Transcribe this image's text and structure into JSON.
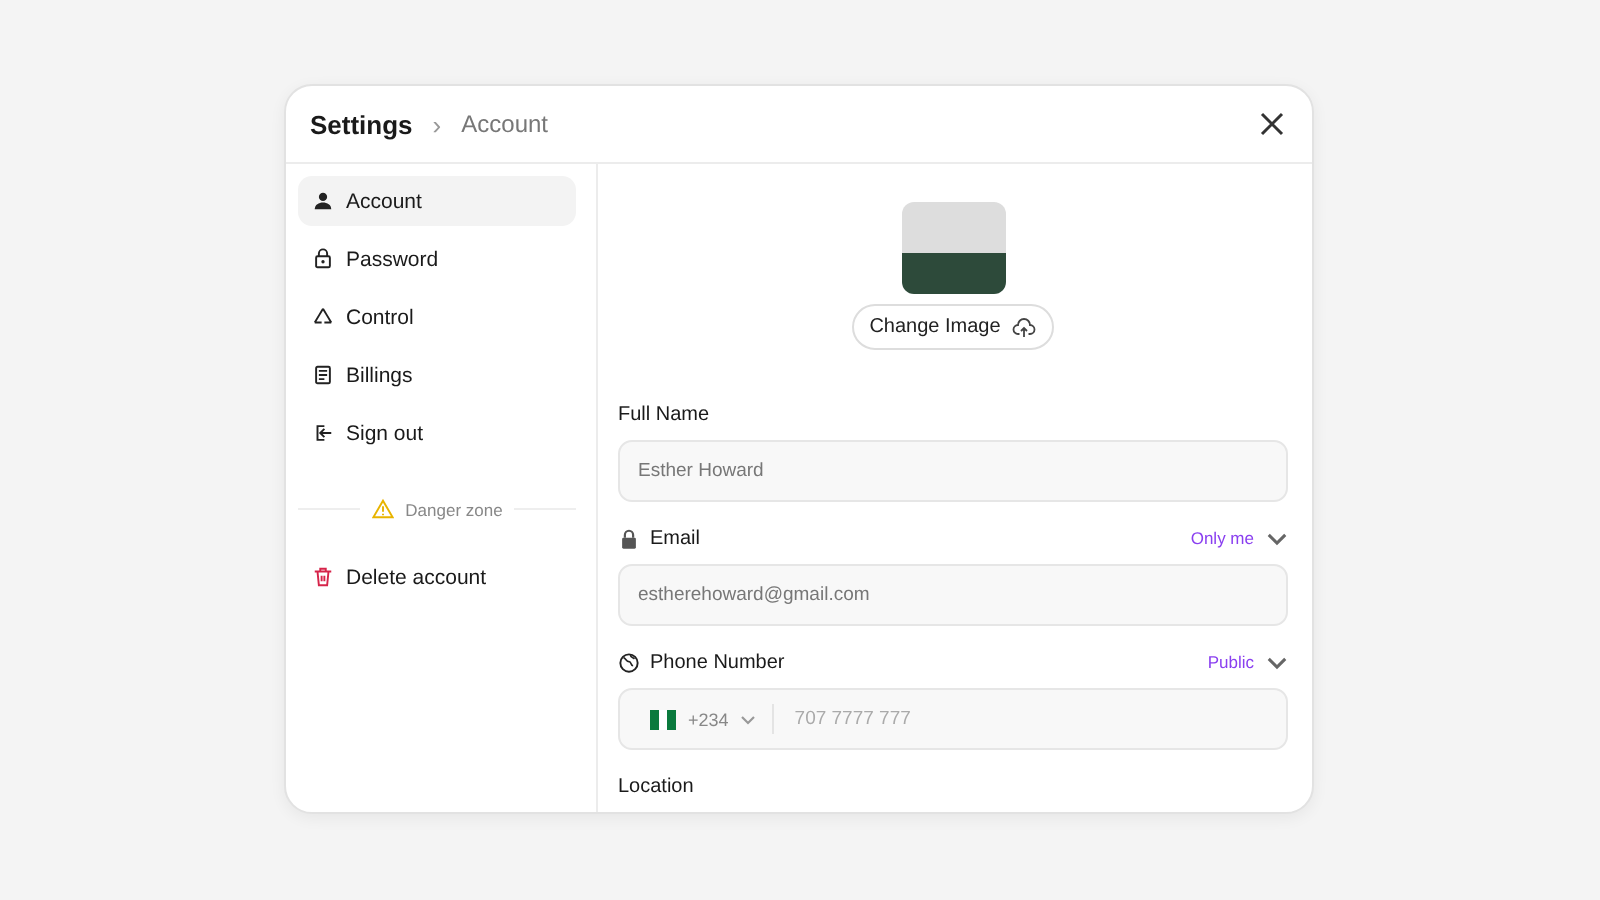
{
  "breadcrumb": {
    "title": "Settings",
    "separator": "›",
    "current": "Account"
  },
  "sidebar": {
    "items": [
      {
        "label": "Account",
        "selected": true
      },
      {
        "label": "Password",
        "selected": false
      },
      {
        "label": "Control",
        "selected": false
      },
      {
        "label": "Billings",
        "selected": false
      },
      {
        "label": "Sign out",
        "selected": false
      }
    ],
    "danger_zone": "Danger zone",
    "danger_items": [
      {
        "label": "Delete account",
        "selected": false
      }
    ]
  },
  "profile": {
    "change_image": "Change Image"
  },
  "fields": [
    {
      "kind": "text",
      "label": "Full Name",
      "value": "Esther Howard"
    },
    {
      "kind": "text",
      "label": "Email",
      "value": "estherehoward@gmail.com",
      "visibility": "Only me"
    },
    {
      "kind": "phone",
      "label": "Phone Number",
      "country_code": "+234",
      "placeholder": "707 7777 777",
      "visibility": "Public"
    },
    {
      "kind": "text",
      "label": "Location"
    }
  ]
}
